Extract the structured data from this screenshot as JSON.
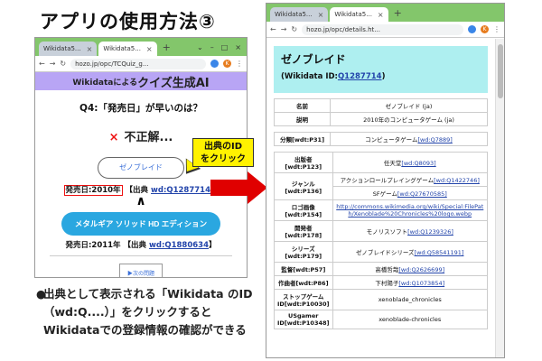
{
  "slide": {
    "title": "アプリの使用方法③",
    "bullet_dot": "●",
    "bullet_text": "出典として表示される「Wikidata のID（wd:Q....）」をクリックするとWikidataでの登録情報の確認ができる"
  },
  "left_browser": {
    "tabs": [
      {
        "label": "Wikidata5...",
        "close": "×"
      },
      {
        "label": "Wikidata5...",
        "close": "×"
      }
    ],
    "new_tab": "+",
    "window_controls": [
      "⌄",
      "–",
      "□",
      "×"
    ],
    "url": "hozo.jp/opc/TCQuiz_g...",
    "profile_initial": "K"
  },
  "quiz": {
    "banner_small": "Wikidataによる",
    "banner_big": "クイズ生成AI",
    "question": "Q4:「発売日」が早いのは？",
    "result_icon": "×",
    "result_text": "不正解...",
    "answer1_label": "ゼノブレイド",
    "answer1_date": "発売日:2010年",
    "answer1_source_prefix": "【出典",
    "answer1_id": "wd:Q1287714",
    "answer1_source_suffix": "】",
    "comparison": "∧",
    "answer2_label": "メタルギア ソリッド HD エディション",
    "answer2_date": "発売日:2011年",
    "answer2_source_prefix": "【出典",
    "answer2_id": "wd:Q1880634",
    "answer2_source_suffix": "】",
    "next_label": "▶次の問題"
  },
  "callout": {
    "line1": "出典のID",
    "line2": "をクリック"
  },
  "right_browser": {
    "tabs": [
      {
        "label": "Wikidata5...",
        "close": "×"
      },
      {
        "label": "Wikidata5...",
        "close": "×"
      }
    ],
    "new_tab": "+",
    "url": "hozo.jp/opc/details.ht...",
    "profile_initial": "K"
  },
  "wikidata": {
    "title": "ゼノブレイド",
    "id_prefix": "(Wikidata ID:",
    "id": "Q1287714",
    "id_suffix": ")",
    "table1": [
      {
        "key": "名前",
        "value": "ゼノブレイド (ja)"
      },
      {
        "key": "説明",
        "value": "2010年のコンピュータゲーム (ja)"
      }
    ],
    "table2": [
      {
        "key": "分類[wdt:P31]",
        "value": "コンピュータゲーム",
        "link": "[wd:Q7889]"
      }
    ],
    "table3": [
      {
        "key": "出版者[wdt:P123]",
        "value": "任天堂",
        "link": "[wd:Q8093]"
      },
      {
        "key": "ジャンル[wdt:P136]",
        "value": "アクションロールプレイングゲーム",
        "link": "[wd:Q1422746]"
      },
      {
        "key": "",
        "value": "SFゲーム",
        "link": "[wd:Q27670585]"
      },
      {
        "key": "ロゴ画像[wdt:P154]",
        "value": "",
        "link": "http://commons.wikimedia.org/wiki/Special:FilePath/Xenoblade%20Chronicles%20logo.webp"
      },
      {
        "key": "開発者[wdt:P178]",
        "value": "モノリスソフト",
        "link": "[wd:Q1239326]"
      },
      {
        "key": "シリーズ[wdt:P179]",
        "value": "ゼノブレイドシリーズ",
        "link": "[wd:Q58541191]"
      },
      {
        "key": "監督[wdt:P57]",
        "value": "高橋哲哉",
        "link": "[wd:Q2626699]"
      },
      {
        "key": "作曲者[wdt:P86]",
        "value": "下村陽子",
        "link": "[wd:Q1073854]"
      },
      {
        "key": "ストップゲームID[wdt:P10030]",
        "value": "xenoblade_chronicles",
        "link": ""
      },
      {
        "key": "USgamer ID[wdt:P10348]",
        "value": "xenoblade-chronicles",
        "link": ""
      }
    ]
  },
  "colors": {
    "browser_green": "#83c66b",
    "quiz_banner": "#b8a5f5",
    "big_button": "#2aa7e0",
    "callout": "#fff200",
    "arrow": "#e00000",
    "wd_header": "#aeeff0",
    "link": "#2244aa"
  }
}
